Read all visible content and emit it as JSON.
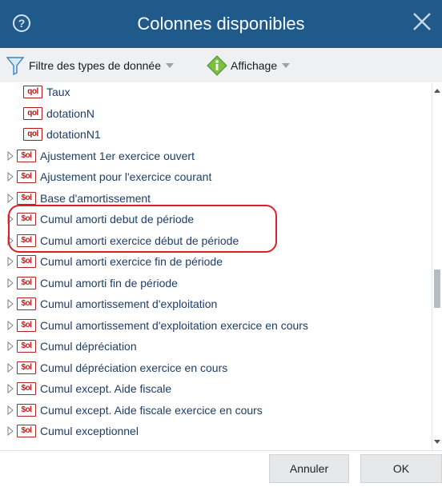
{
  "dialog": {
    "title": "Colonnes disponibles",
    "help_glyph": "?"
  },
  "toolbar": {
    "filter_label": "Filtre des types de donnée",
    "display_label": "Affichage"
  },
  "list": {
    "items": [
      {
        "label": "Taux",
        "icon": "qol",
        "expandable": false
      },
      {
        "label": "dotationN",
        "icon": "qol",
        "expandable": false
      },
      {
        "label": "dotationN1",
        "icon": "qol",
        "expandable": false
      },
      {
        "label": "Ajustement 1er exercice ouvert",
        "icon": "$ol",
        "expandable": true
      },
      {
        "label": "Ajustement pour l'exercice courant",
        "icon": "$ol",
        "expandable": true
      },
      {
        "label": "Base d'amortissement",
        "icon": "$ol",
        "expandable": true
      },
      {
        "label": "Cumul amorti debut de période",
        "icon": "$ol",
        "expandable": true
      },
      {
        "label": "Cumul amorti exercice début de période",
        "icon": "$ol",
        "expandable": true
      },
      {
        "label": "Cumul amorti exercice fin de période",
        "icon": "$ol",
        "expandable": true
      },
      {
        "label": "Cumul amorti fin de période",
        "icon": "$ol",
        "expandable": true
      },
      {
        "label": "Cumul amortissement d'exploitation",
        "icon": "$ol",
        "expandable": true
      },
      {
        "label": "Cumul amortissement d'exploitation exercice en cours",
        "icon": "$ol",
        "expandable": true
      },
      {
        "label": "Cumul dépréciation",
        "icon": "$ol",
        "expandable": true
      },
      {
        "label": "Cumul dépréciation exercice en cours",
        "icon": "$ol",
        "expandable": true
      },
      {
        "label": "Cumul except. Aide fiscale",
        "icon": "$ol",
        "expandable": true
      },
      {
        "label": "Cumul except. Aide fiscale exercice en cours",
        "icon": "$ol",
        "expandable": true
      },
      {
        "label": "Cumul exceptionnel",
        "icon": "$ol",
        "expandable": true
      }
    ]
  },
  "buttons": {
    "cancel": "Annuler",
    "ok": "OK"
  },
  "colors": {
    "titlebar": "#1f5a8a",
    "highlight": "#e31c2a",
    "icon_red": "#b31616"
  }
}
